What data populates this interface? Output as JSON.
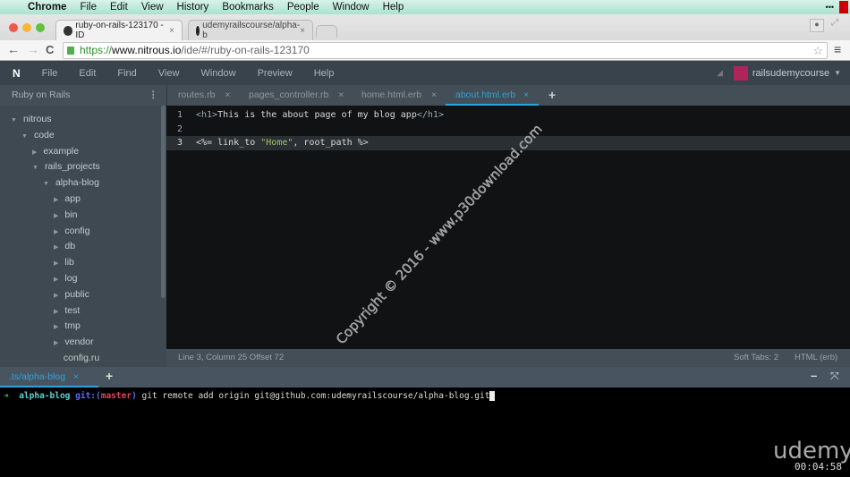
{
  "os_menu": {
    "apple": "apple-icon",
    "items": [
      "Chrome",
      "File",
      "Edit",
      "View",
      "History",
      "Bookmarks",
      "People",
      "Window",
      "Help"
    ]
  },
  "browser": {
    "tabs": [
      {
        "title": "ruby-on-rails-123170 - ID",
        "active": true
      },
      {
        "title": "udemyrailscourse/alpha-b",
        "active": false
      }
    ],
    "url_scheme": "https://",
    "url_host": "www.nitrous.io",
    "url_path": "/ide/#/ruby-on-rails-123170"
  },
  "ide": {
    "logo": "N",
    "menu": [
      "File",
      "Edit",
      "Find",
      "View",
      "Window",
      "Preview",
      "Help"
    ],
    "user": "railsudemycourse",
    "project": "Ruby on Rails",
    "editor_tabs": [
      {
        "label": "routes.rb"
      },
      {
        "label": "pages_controller.rb"
      },
      {
        "label": "home.html.erb"
      },
      {
        "label": "about.html.erb",
        "active": true
      }
    ],
    "tree": [
      {
        "label": "nitrous",
        "depth": 0,
        "type": "open"
      },
      {
        "label": "code",
        "depth": 1,
        "type": "open"
      },
      {
        "label": "example",
        "depth": 2,
        "type": "closed"
      },
      {
        "label": "rails_projects",
        "depth": 2,
        "type": "open"
      },
      {
        "label": "alpha-blog",
        "depth": 3,
        "type": "open"
      },
      {
        "label": "app",
        "depth": 4,
        "type": "closed"
      },
      {
        "label": "bin",
        "depth": 4,
        "type": "closed"
      },
      {
        "label": "config",
        "depth": 4,
        "type": "closed"
      },
      {
        "label": "db",
        "depth": 4,
        "type": "closed"
      },
      {
        "label": "lib",
        "depth": 4,
        "type": "closed"
      },
      {
        "label": "log",
        "depth": 4,
        "type": "closed"
      },
      {
        "label": "public",
        "depth": 4,
        "type": "closed"
      },
      {
        "label": "test",
        "depth": 4,
        "type": "closed"
      },
      {
        "label": "tmp",
        "depth": 4,
        "type": "closed"
      },
      {
        "label": "vendor",
        "depth": 4,
        "type": "closed"
      },
      {
        "label": "config.ru",
        "depth": 4,
        "type": "file"
      }
    ],
    "code": {
      "line1": {
        "num": "1",
        "open": "<h1>",
        "text": "This is the about page of my blog app",
        "close": "</h1>"
      },
      "line2": {
        "num": "2"
      },
      "line3": {
        "num": "3",
        "a": "<%= ",
        "b": "link_to ",
        "str": "\"Home\"",
        "c": ", root_path %>"
      }
    },
    "status": {
      "position": "Line 3, Column 25 Offset 72",
      "tabs": "Soft Tabs: 2",
      "mode": "HTML (erb)"
    },
    "terminal": {
      "tab": ".ts/alpha-blog",
      "prompt_arrow": "➜",
      "dir": "alpha-blog",
      "git": "git:(",
      "branch": "master",
      "git_end": ")",
      "command": "git remote add origin git@github.com:udemyrailscourse/alpha-blog.git"
    }
  },
  "watermark": "Copyright © 2016 - www.p30download.com",
  "video": {
    "brand": "udemy",
    "time": "00:04:58"
  },
  "colors": {
    "accent": "#2ea3dc",
    "string": "#9ec36a",
    "branch": "#e0455a"
  }
}
